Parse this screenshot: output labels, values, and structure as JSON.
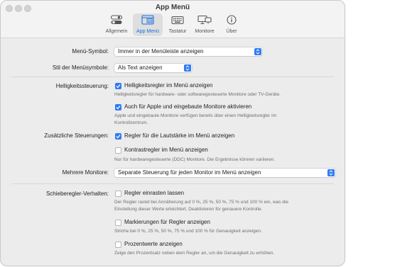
{
  "window": {
    "title": "App Menü"
  },
  "tabs": [
    {
      "label": "Allgemein",
      "icon": "toggle-icon"
    },
    {
      "label": "App Menü",
      "icon": "menu-window-icon",
      "active": true
    },
    {
      "label": "Tastatur",
      "icon": "keyboard-icon"
    },
    {
      "label": "Monitore",
      "icon": "displays-icon"
    },
    {
      "label": "Über",
      "icon": "info-icon"
    }
  ],
  "accent_color": "#2f7bf5",
  "settings": {
    "menu_symbol": {
      "label": "Menü-Symbol:",
      "value": "Immer in der Menüleiste anzeigen"
    },
    "icon_style": {
      "label": "Stil der Menüsymbole:",
      "value": "Als Text anzeigen"
    },
    "brightness": {
      "label": "Helligkeitssteuerung:",
      "opt1": {
        "text": "Helligkeitsregler im Menü anzeigen",
        "checked": true,
        "desc": "Helligkeitsregler für hardware- oder softwaregesteuerte Monitore oder TV-Geräte."
      },
      "opt2": {
        "text": "Auch für Apple und eingebaute Monitore aktivieren",
        "checked": true,
        "desc_line1": "Apple und eingebaute Monitore verfügen bereits über einen Helligkeitsregler im",
        "desc_line2": "Kontrollzentrum."
      }
    },
    "additional": {
      "label": "Zusätzliche Steuerungen:",
      "opt1": {
        "text": "Regler für die Lautstärke im Menü anzeigen",
        "checked": true
      },
      "opt2": {
        "text": "Kontrastregler im Menü anzeigen",
        "checked": false,
        "desc": "Nur für hardwaregesteuerte (DDC) Monitore. Die Ergebnisse können variieren."
      }
    },
    "multiple_monitors": {
      "label": "Mehrere Monitore:",
      "value": "Separate Steuerung für jeden Monitor im Menü anzeigen"
    },
    "slider_behavior": {
      "label": "Schieberegler-Verhalten:",
      "opt1": {
        "text": "Regler einrasten lassen",
        "checked": false,
        "desc_line1": "Der Regler rastet bei Annäherung auf 0 %, 25 %, 50 %, 75 % und 100 % ein, was die",
        "desc_line2": "Einstellung dieser Werte erleichtert. Deaktivieren für genauere Kontrolle."
      },
      "opt2": {
        "text": "Markierungen für Regler anzeigen",
        "checked": false,
        "desc": "Striche bei 0 %, 25 %, 50 %, 75 % und 100 % für Genauigkeit anzeigen."
      },
      "opt3": {
        "text": "Prozentwerte anzeigen",
        "checked": false,
        "desc": "Zeige den Prozentsatz neben dem Regler an, um die Genauigkeit zu erhöhen."
      }
    }
  }
}
